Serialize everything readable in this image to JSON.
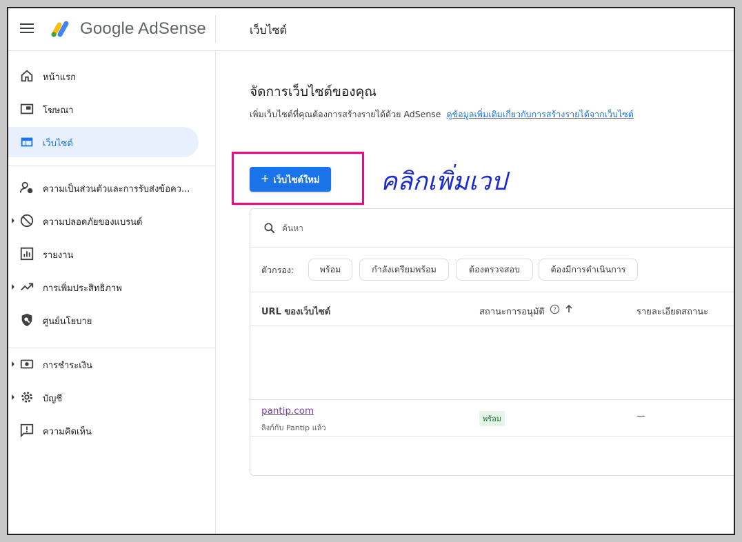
{
  "header": {
    "brand": "Google AdSense",
    "page_title": "เว็บไซต์"
  },
  "sidebar": {
    "items": [
      {
        "label": "หน้าแรก",
        "icon": "home-icon"
      },
      {
        "label": "โฆษณา",
        "icon": "ads-icon"
      },
      {
        "label": "เว็บไซต์",
        "icon": "sites-icon",
        "active": true
      },
      {
        "label": "ความเป็นส่วนตัวและการรับส่งข้อคว...",
        "icon": "privacy-icon"
      },
      {
        "label": "ความปลอดภัยของแบรนด์",
        "icon": "block-icon",
        "expandable": true
      },
      {
        "label": "รายงาน",
        "icon": "reports-icon"
      },
      {
        "label": "การเพิ่มประสิทธิภาพ",
        "icon": "trending-icon",
        "expandable": true
      },
      {
        "label": "ศูนย์นโยบาย",
        "icon": "policy-icon"
      },
      {
        "label": "การชำระเงิน",
        "icon": "payments-icon",
        "expandable": true
      },
      {
        "label": "บัญชี",
        "icon": "gear-icon",
        "expandable": true
      },
      {
        "label": "ความคิดเห็น",
        "icon": "feedback-icon"
      }
    ]
  },
  "main": {
    "title": "จัดการเว็บไซต์ของคุณ",
    "subtitle": "เพิ่มเว็บไซต์ที่คุณต้องการสร้างรายได้ด้วย AdSense",
    "subtitle_link": "ดูข้อมูลเพิ่มเติมเกี่ยวกับการสร้างรายได้จากเว็บไซต์",
    "new_site_button": "เว็บไซต์ใหม่",
    "annotation": "คลิกเพิ่มเวป",
    "search_placeholder": "ค้นหา",
    "filter_label": "ตัวกรอง:",
    "filters": [
      "พร้อม",
      "กำลังเตรียมพร้อม",
      "ต้องตรวจสอบ",
      "ต้องมีการดำเนินการ"
    ],
    "columns": {
      "url": "URL ของเว็บไซต์",
      "status": "สถานะการอนุมัติ",
      "details": "รายละเอียดสถานะ"
    },
    "rows": [
      {
        "site": "pantip.com",
        "sub": "ลิงก์กับ Pantip แล้ว",
        "status": "พร้อม",
        "details": "—"
      }
    ]
  },
  "colors": {
    "accent": "#1a73e8",
    "highlight": "#d6157f",
    "annotation": "#1c2bd1",
    "status_ready_bg": "#e6f4ea",
    "status_ready_text": "#137333"
  }
}
